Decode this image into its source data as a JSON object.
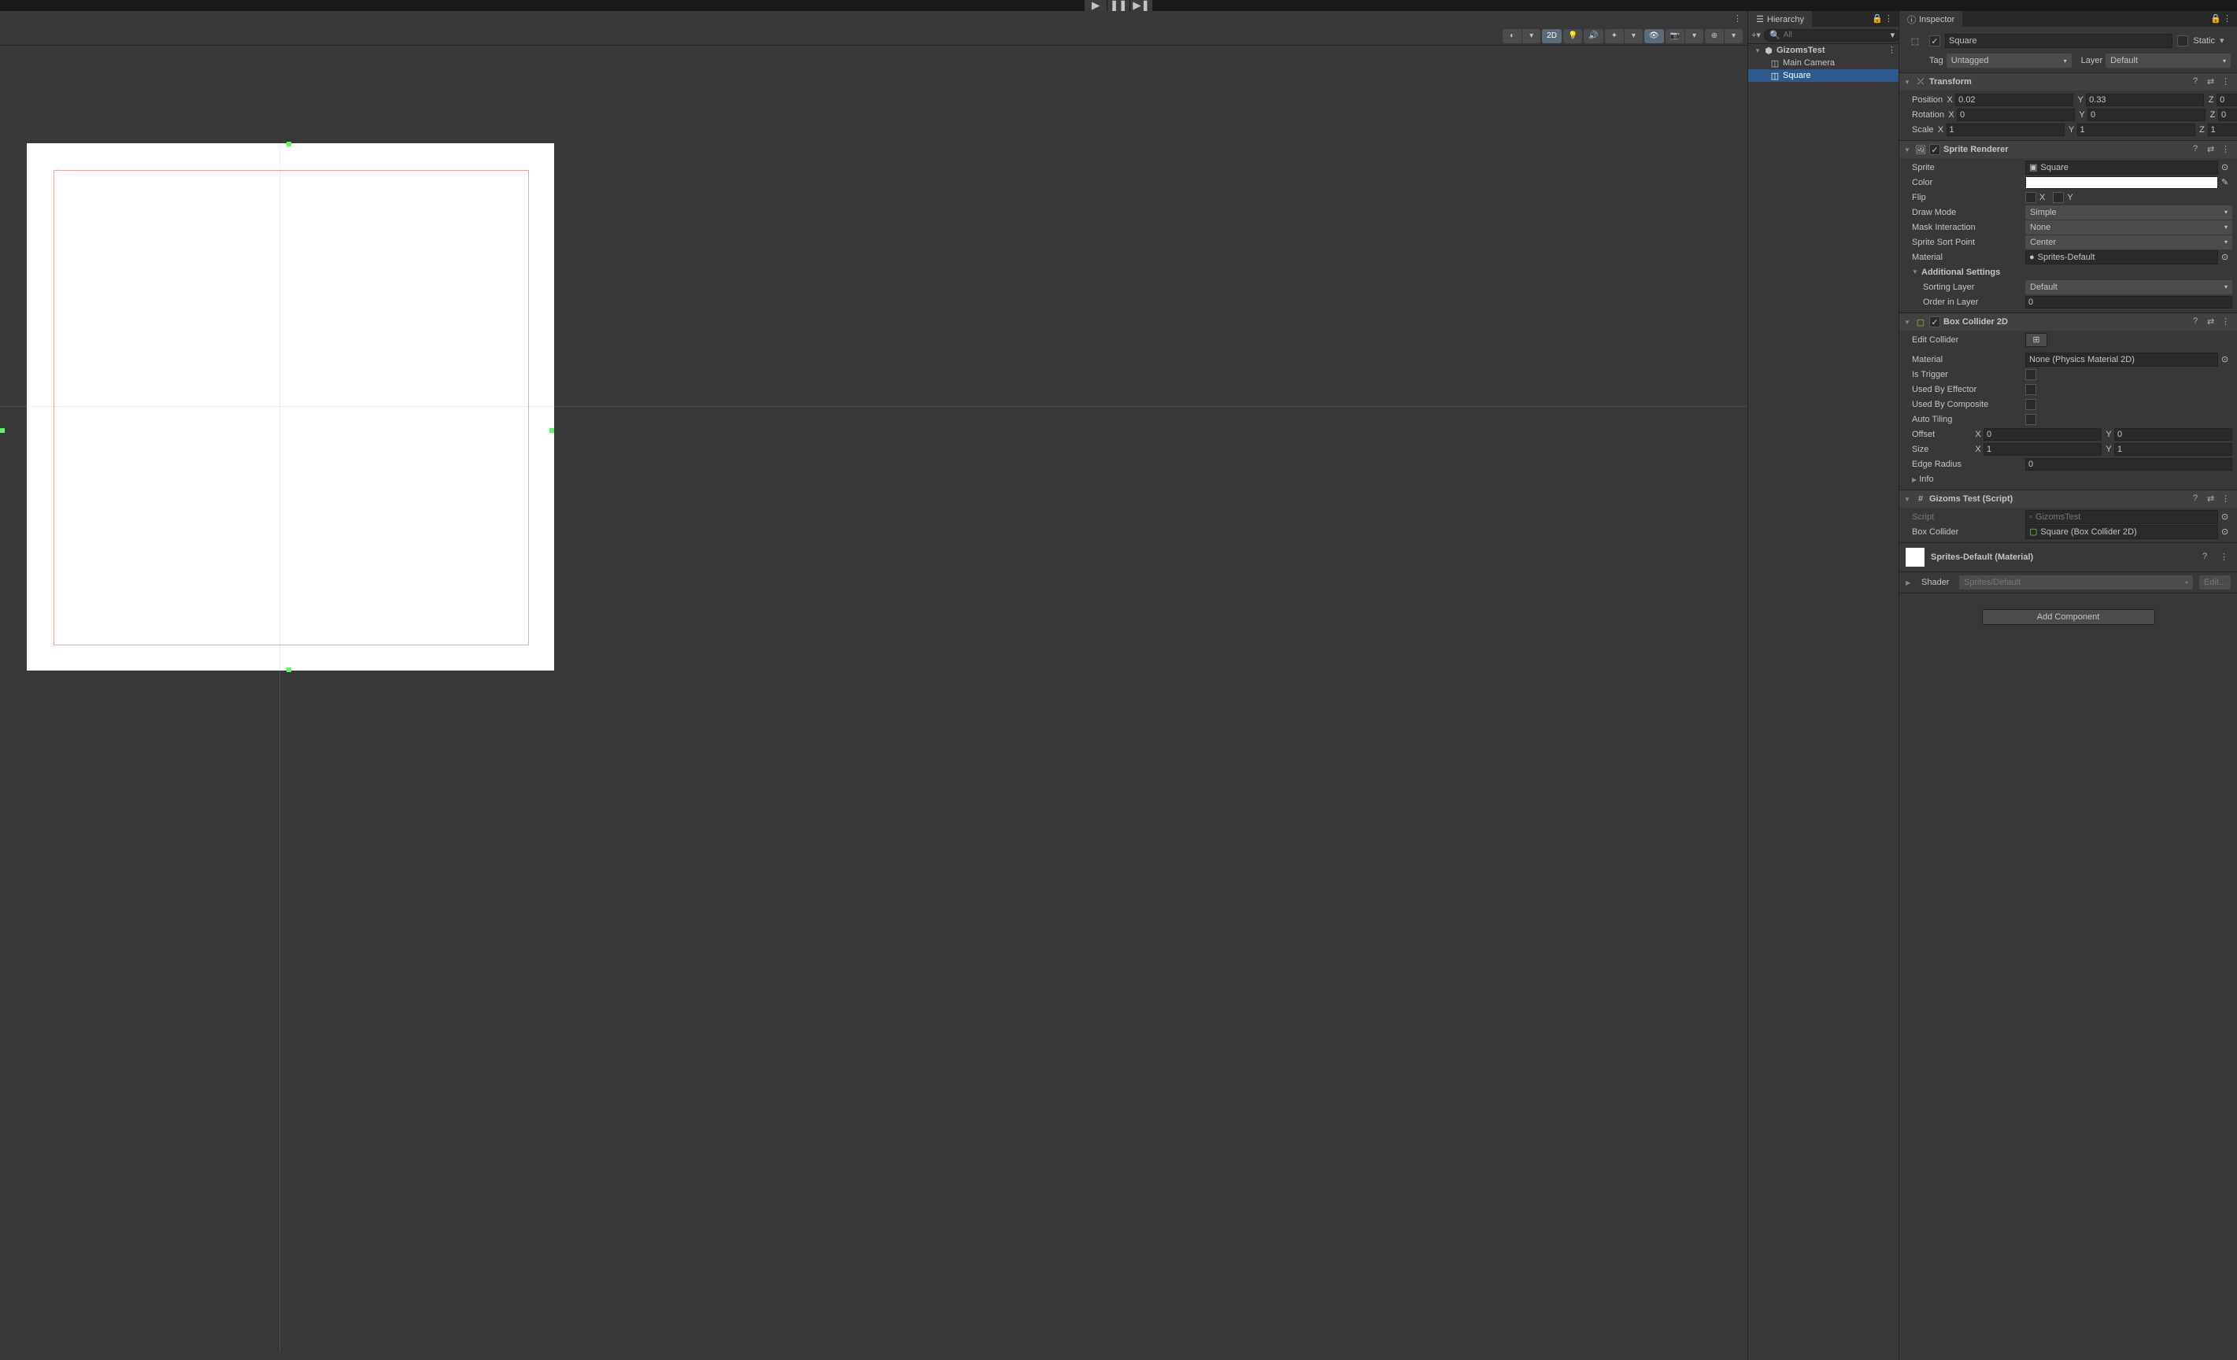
{
  "hierarchy": {
    "tab_label": "Hierarchy",
    "search_placeholder": "All",
    "root": "GizomsTest",
    "items": [
      "Main Camera",
      "Square"
    ]
  },
  "scene_toolbar": {
    "mode_2d": "2D"
  },
  "inspector": {
    "tab_label": "Inspector",
    "object_name": "Square",
    "static_label": "Static",
    "tag_label": "Tag",
    "tag_value": "Untagged",
    "layer_label": "Layer",
    "layer_value": "Default"
  },
  "transform": {
    "title": "Transform",
    "position_label": "Position",
    "position": {
      "x": "0.02",
      "y": "0.33",
      "z": "0"
    },
    "rotation_label": "Rotation",
    "rotation": {
      "x": "0",
      "y": "0",
      "z": "0"
    },
    "scale_label": "Scale",
    "scale": {
      "x": "1",
      "y": "1",
      "z": "1"
    }
  },
  "sprite_renderer": {
    "title": "Sprite Renderer",
    "sprite_label": "Sprite",
    "sprite_value": "Square",
    "color_label": "Color",
    "flip_label": "Flip",
    "flip_x": "X",
    "flip_y": "Y",
    "draw_mode_label": "Draw Mode",
    "draw_mode_value": "Simple",
    "mask_interaction_label": "Mask Interaction",
    "mask_interaction_value": "None",
    "sprite_sort_point_label": "Sprite Sort Point",
    "sprite_sort_point_value": "Center",
    "material_label": "Material",
    "material_value": "Sprites-Default",
    "additional_settings_label": "Additional Settings",
    "sorting_layer_label": "Sorting Layer",
    "sorting_layer_value": "Default",
    "order_in_layer_label": "Order in Layer",
    "order_in_layer_value": "0"
  },
  "box_collider": {
    "title": "Box Collider 2D",
    "edit_collider_label": "Edit Collider",
    "material_label": "Material",
    "material_value": "None (Physics Material 2D)",
    "is_trigger_label": "Is Trigger",
    "used_by_effector_label": "Used By Effector",
    "used_by_composite_label": "Used By Composite",
    "auto_tiling_label": "Auto Tiling",
    "offset_label": "Offset",
    "offset": {
      "x": "0",
      "y": "0"
    },
    "size_label": "Size",
    "size": {
      "x": "1",
      "y": "1"
    },
    "edge_radius_label": "Edge Radius",
    "edge_radius_value": "0",
    "info_label": "Info"
  },
  "gizoms_test": {
    "title": "Gizoms Test (Script)",
    "script_label": "Script",
    "script_value": "GizomsTest",
    "box_collider_label": "Box Collider",
    "box_collider_value": "Square (Box Collider 2D)"
  },
  "material": {
    "title": "Sprites-Default (Material)",
    "shader_label": "Shader",
    "shader_value": "Sprites/Default",
    "edit_label": "Edit..."
  },
  "add_component_label": "Add Component",
  "axis": {
    "x": "X",
    "y": "Y",
    "z": "Z"
  }
}
